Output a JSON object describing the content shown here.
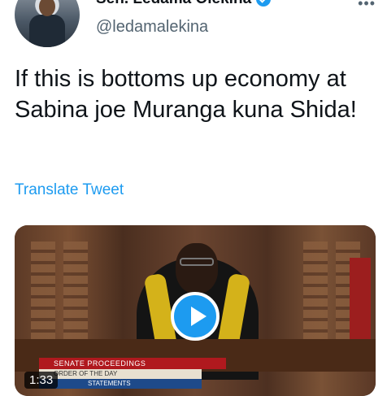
{
  "author": {
    "display_name": "Sen. Ledama Olekina",
    "handle": "@ledamalekina",
    "verified": true
  },
  "tweet": {
    "text": "If this is bottoms up economy at Sabina joe Muranga kuna Shida!",
    "translate_label": "Translate Tweet"
  },
  "media": {
    "type": "video",
    "duration": "1:33",
    "overlay_banner": "SENATE PROCEEDINGS",
    "overlay_line2": "ORDER OF THE DAY",
    "overlay_line3": "STATEMENTS"
  },
  "icons": {
    "verified": "verified-badge-icon",
    "play": "play-icon",
    "more": "more-options-icon"
  },
  "colors": {
    "accent": "#1d9bf0",
    "text": "#0f1419",
    "secondary": "#536471"
  }
}
